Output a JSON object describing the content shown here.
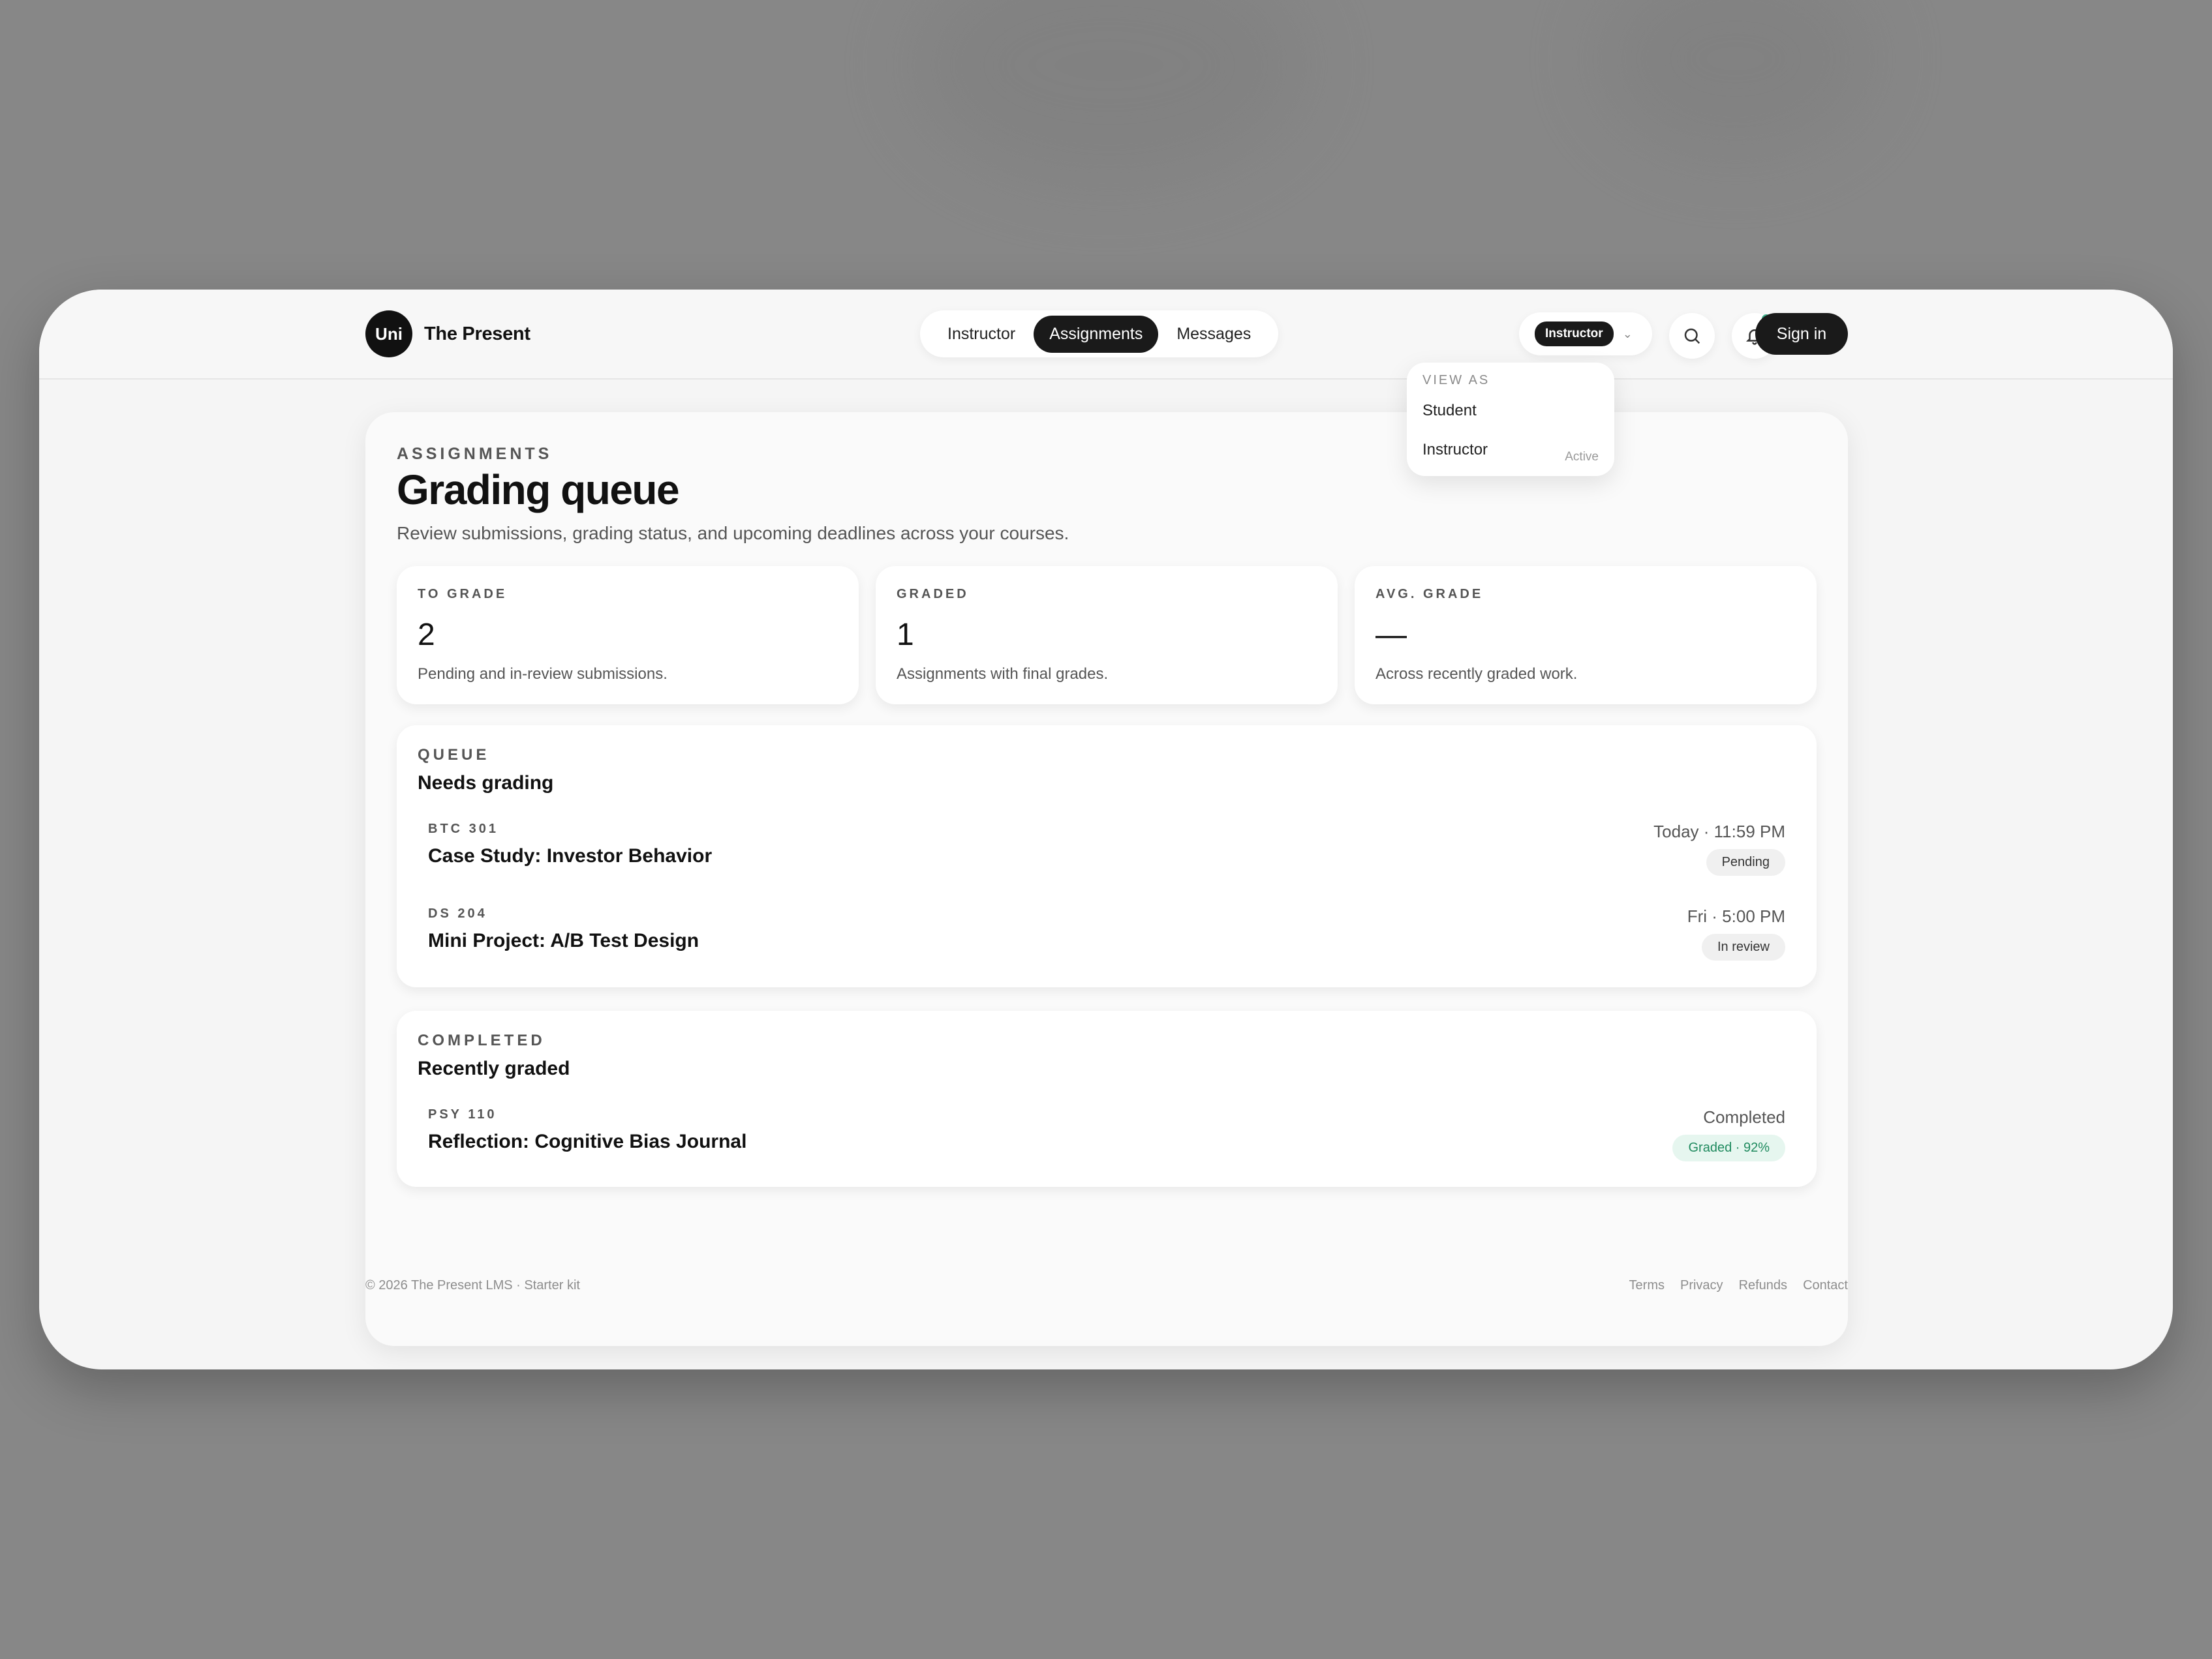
{
  "brand": {
    "logo_text": "Uni",
    "name": "The Present"
  },
  "nav": {
    "items": [
      "Instructor",
      "Assignments",
      "Messages"
    ],
    "active": "Assignments"
  },
  "role_switcher": {
    "current": "Instructor",
    "dropdown": {
      "heading": "VIEW AS",
      "options": [
        "Student",
        "Instructor"
      ],
      "active_label": "Active"
    }
  },
  "icons": {
    "search": "search-icon",
    "notifications": "bell-icon",
    "notification_dot_color": "#3fb08c"
  },
  "auth": {
    "sign_in_label": "Sign in"
  },
  "page": {
    "eyebrow": "ASSIGNMENTS",
    "title": "Grading queue",
    "subtitle": "Review submissions, grading status, and upcoming deadlines across your courses."
  },
  "stats": [
    {
      "label": "TO GRADE",
      "value": "2",
      "desc": "Pending and in-review submissions."
    },
    {
      "label": "GRADED",
      "value": "1",
      "desc": "Assignments with final grades."
    },
    {
      "label": "AVG. GRADE",
      "value": "—",
      "desc": "Across recently graded work."
    }
  ],
  "queue": {
    "eyebrow": "QUEUE",
    "title": "Needs grading",
    "rows": [
      {
        "code": "BTC 301",
        "title": "Case Study: Investor Behavior",
        "time": "Today · 11:59 PM",
        "status": "Pending"
      },
      {
        "code": "DS 204",
        "title": "Mini Project: A/B Test Design",
        "time": "Fri · 5:00 PM",
        "status": "In review"
      }
    ]
  },
  "completed": {
    "eyebrow": "COMPLETED",
    "title": "Recently graded",
    "rows": [
      {
        "code": "PSY 110",
        "title": "Reflection: Cognitive Bias Journal",
        "time": "Completed",
        "status": "Graded · 92%"
      }
    ]
  },
  "footer": {
    "copyright": "© 2026 The Present LMS · Starter kit",
    "links": [
      "Terms",
      "Privacy",
      "Refunds",
      "Contact"
    ]
  },
  "colors": {
    "accent_dark": "#1a1a1a",
    "success_bg": "#e6f6ef",
    "success_text": "#1f8a5e"
  }
}
